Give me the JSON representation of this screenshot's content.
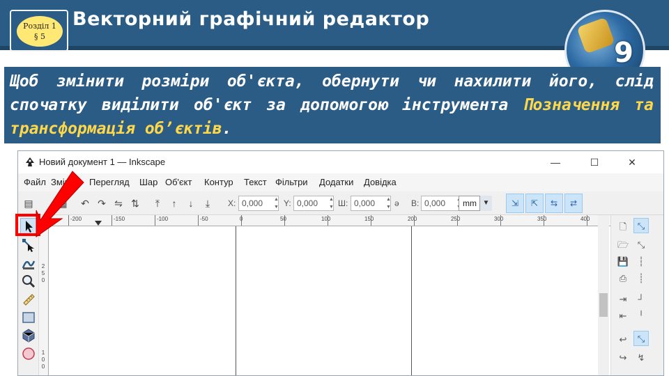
{
  "slide": {
    "section_line1": "Розділ 1",
    "section_line2": "§ 5",
    "title": "Векторний графічний редактор",
    "grade_number": "9",
    "instruction_part1": "Щоб змінити розміри об'єкта, обернути чи нахилити його, слід спочатку виділити об'єкт за допомогою інструмента ",
    "instruction_highlight": "Позначення та трансформація об’єктів",
    "instruction_end": "."
  },
  "window": {
    "title": "Новий документ 1 — Inkscape",
    "minimize": "—",
    "maximize": "☐",
    "close": "✕"
  },
  "menu": [
    "Файл",
    "Зміни",
    "Перегляд",
    "Шар",
    "Об'єкт",
    "Контур",
    "Текст",
    "Фільтри",
    "Додатки",
    "Довідка"
  ],
  "toolbar": {
    "x_label": "X:",
    "x_value": "0,000",
    "y_label": "Y:",
    "y_value": "0,000",
    "w_label": "Ш:",
    "w_value": "0,000",
    "lock": "ə",
    "h_label": "В:",
    "h_value": "0,000",
    "unit": "mm"
  },
  "ruler": {
    "h_labels": [
      "-200",
      "-150",
      "-100",
      "-50",
      "0",
      "50",
      "100",
      "150",
      "200",
      "250",
      "300",
      "350",
      "400"
    ],
    "v_labels": [
      "2",
      "5",
      "0",
      "1",
      "0",
      "0"
    ]
  },
  "icons": {
    "app": "inkscape-logo-icon",
    "select": "selector-arrow-icon",
    "node": "node-editor-icon",
    "tweak": "tweak-icon",
    "zoom": "zoom-icon",
    "measure": "measure-icon",
    "rect": "rectangle-icon",
    "box3d": "3d-box-icon",
    "ellipse": "ellipse-icon"
  },
  "colors": {
    "slide_blue": "#2a5c86",
    "highlight_text": "#ffd84a",
    "arrow_red": "#ff0000",
    "active_tool_bg": "#cfe2f5"
  }
}
